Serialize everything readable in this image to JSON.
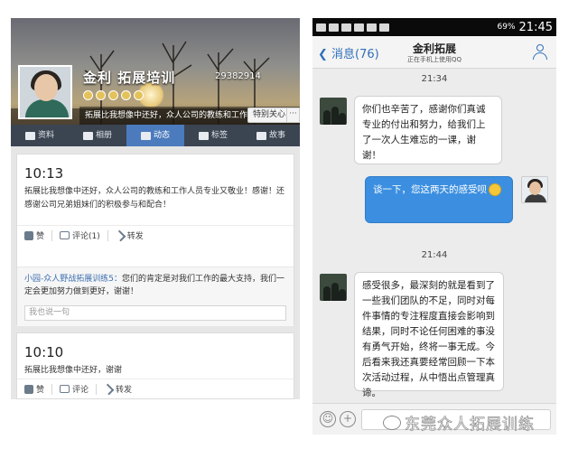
{
  "left": {
    "profile": {
      "name": "金利 拓展培训",
      "id": "29382914",
      "bio": "拓展比我想像中还好，众人公司的教练和工作...",
      "follow_label": "特别关心",
      "more_label": "···"
    },
    "tabs": [
      {
        "label": "资料",
        "icon": "profile-icon"
      },
      {
        "label": "相册",
        "icon": "album-icon"
      },
      {
        "label": "动态",
        "icon": "feed-icon"
      },
      {
        "label": "标签",
        "icon": "tag-icon"
      },
      {
        "label": "故事",
        "icon": "story-icon"
      }
    ],
    "active_tab": "动态",
    "posts": [
      {
        "time": "10:13",
        "text": "拓展比我想像中还好，众人公司的教练和工作人员专业又敬业！感谢！还感谢公司兄弟姐妹们的积极参与和配合！",
        "like_label": "赞",
        "comment_label": "评论(1)",
        "share_label": "转发",
        "reply_author": "小园-众人野战拓展训练5：",
        "reply_text": "您们的肯定是对我们工作的最大支持，我们一定会更加努力做到更好，谢谢！",
        "reply_placeholder": "我也说一句"
      },
      {
        "time": "10:10",
        "text": "拓展比我想像中还好，谢谢",
        "like_label": "赞",
        "comment_label": "评论",
        "share_label": "转发"
      }
    ]
  },
  "right": {
    "status": {
      "battery": "69%",
      "clock": "21:45"
    },
    "header": {
      "back_label": "消息(76)",
      "title": "金利拓展",
      "subtitle": "正在手机上使用QQ"
    },
    "messages": [
      {
        "type": "time",
        "text": "21:34"
      },
      {
        "type": "in",
        "text": "你们也辛苦了，感谢你们真诚专业的付出和努力，给我们上了一次人生难忘的一课，谢谢！"
      },
      {
        "type": "out",
        "text": "谈一下，您这两天的感受呗"
      },
      {
        "type": "time",
        "text": "21:44"
      },
      {
        "type": "in",
        "text": "感受很多，最深刻的就是看到了一些我们团队的不足，同时对每件事情的专注程度直接会影响到结果，同时不论任何困难的事没有勇气开始，终将一事无成。今后看来我还真要经常回顾一下本次活动过程，从中悟出点管理真谛。"
      }
    ]
  },
  "watermark": "东莞众人拓展训练",
  "colors": {
    "accent": "#3c8fe0",
    "tab_active": "#4b7bbd",
    "tab_bar": "#3b4451"
  }
}
